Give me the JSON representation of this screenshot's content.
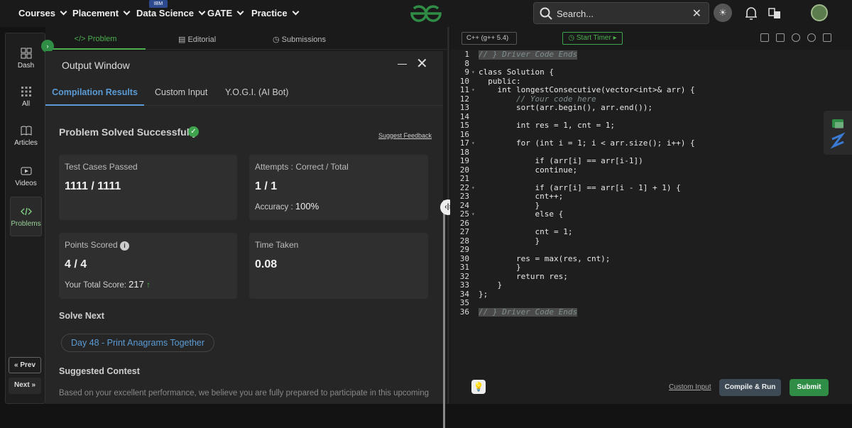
{
  "nav": {
    "items": [
      "Courses",
      "Placement",
      "Data Science",
      "GATE",
      "Practice"
    ],
    "ibm_badge": "IBM",
    "search_placeholder": "Search..."
  },
  "sidebar": {
    "items": [
      "Dash",
      "All",
      "Articles",
      "Videos",
      "Problems"
    ],
    "prev": "Prev",
    "next": "Next"
  },
  "problem_tabs": [
    "Problem",
    "Editorial",
    "Submissions"
  ],
  "output": {
    "title": "Output Window",
    "tabs": [
      "Compilation Results",
      "Custom Input",
      "Y.O.G.I. (AI Bot)"
    ],
    "status": "Problem Solved Successfully",
    "feedback": "Suggest Feedback",
    "tests_label": "Test Cases Passed",
    "tests_value": "1111 / 1111",
    "attempts_label": "Attempts : Correct / Total",
    "attempts_value": "1 / 1",
    "accuracy_label": "Accuracy :",
    "accuracy_value": "100%",
    "points_label": "Points Scored",
    "points_value": "4 / 4",
    "total_score_label": "Your Total Score:",
    "total_score_value": "217",
    "time_label": "Time Taken",
    "time_value": "0.08",
    "solve_next_label": "Solve Next",
    "solve_next_item": "Day 48 - Print Anagrams Together",
    "contest_label": "Suggested Contest",
    "contest_text": "Based on your excellent performance, we believe you are fully prepared to participate in this upcoming"
  },
  "editor": {
    "language": "C++ (g++ 5.4)",
    "timer": "Start Timer",
    "custom_input": "Custom Input",
    "compile_run": "Compile & Run",
    "submit": "Submit",
    "lines": [
      {
        "n": "1",
        "t": "// } Driver Code Ends"
      },
      {
        "n": "8",
        "t": ""
      },
      {
        "n": "9",
        "t": "class Solution {"
      },
      {
        "n": "10",
        "t": "  public:"
      },
      {
        "n": "11",
        "t": "    int longestConsecutive(vector<int>& arr) {"
      },
      {
        "n": "12",
        "t": "        // Your code here"
      },
      {
        "n": "13",
        "t": "        sort(arr.begin(), arr.end());"
      },
      {
        "n": "14",
        "t": ""
      },
      {
        "n": "15",
        "t": "        int res = 1, cnt = 1;"
      },
      {
        "n": "16",
        "t": ""
      },
      {
        "n": "17",
        "t": "        for (int i = 1; i < arr.size(); i++) {"
      },
      {
        "n": "18",
        "t": ""
      },
      {
        "n": "19",
        "t": "            if (arr[i] == arr[i-1])"
      },
      {
        "n": "20",
        "t": "            continue;"
      },
      {
        "n": "21",
        "t": ""
      },
      {
        "n": "22",
        "t": "            if (arr[i] == arr[i - 1] + 1) {"
      },
      {
        "n": "23",
        "t": "            cnt++;"
      },
      {
        "n": "24",
        "t": "            }"
      },
      {
        "n": "25",
        "t": "            else {"
      },
      {
        "n": "26",
        "t": ""
      },
      {
        "n": "27",
        "t": "            cnt = 1;"
      },
      {
        "n": "28",
        "t": "            }"
      },
      {
        "n": "29",
        "t": ""
      },
      {
        "n": "30",
        "t": "        res = max(res, cnt);"
      },
      {
        "n": "31",
        "t": "        }"
      },
      {
        "n": "32",
        "t": "        return res;"
      },
      {
        "n": "33",
        "t": "    }"
      },
      {
        "n": "34",
        "t": "};"
      },
      {
        "n": "35",
        "t": ""
      },
      {
        "n": "36",
        "t": "// } Driver Code Ends"
      }
    ]
  },
  "colors": {
    "accent_green": "#2f8d46",
    "link_blue": "#5b9bd5"
  }
}
